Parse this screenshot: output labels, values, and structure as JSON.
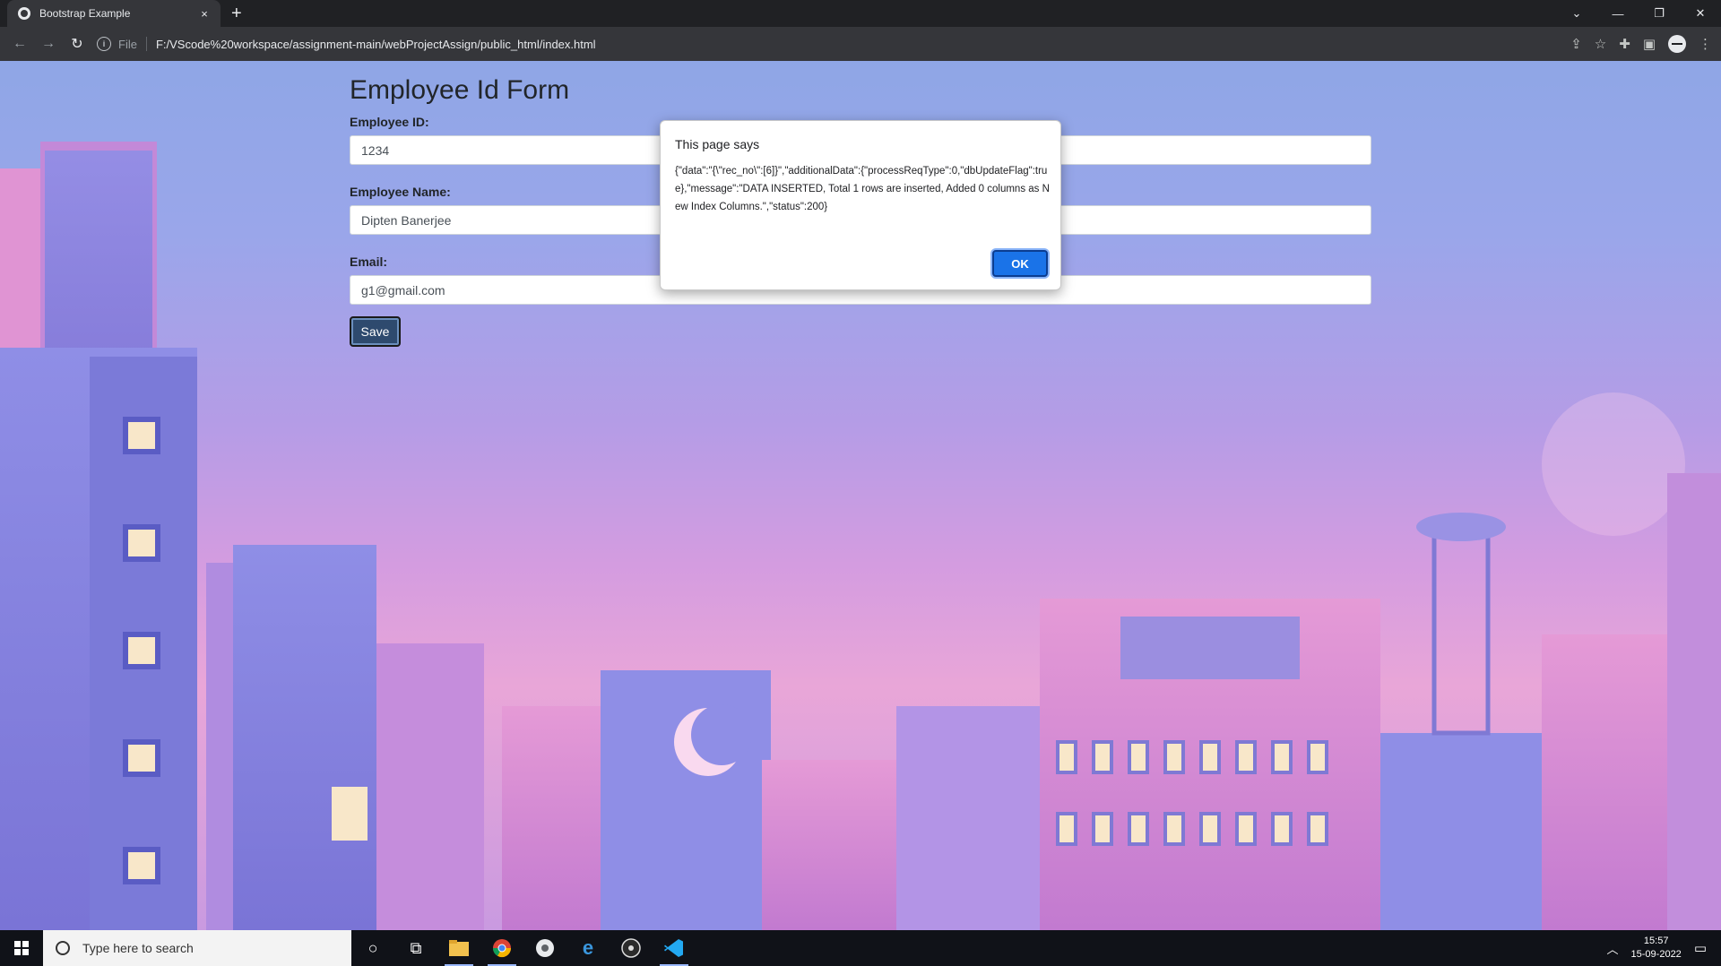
{
  "browser": {
    "tab_title": "Bootstrap Example",
    "tab_close": "×",
    "new_tab": "+",
    "scheme": "File",
    "url": "F:/VScode%20workspace/assignment-main/webProjectAssign/public_html/index.html"
  },
  "form": {
    "title": "Employee Id Form",
    "fields": [
      {
        "label": "Employee ID:",
        "value": "1234"
      },
      {
        "label": "Employee Name:",
        "value": "Dipten Banerjee"
      },
      {
        "label": "Email:",
        "value": "g1@gmail.com"
      }
    ],
    "save_label": "Save"
  },
  "dialog": {
    "title": "This page says",
    "message": "{\"data\":\"{\\\"rec_no\\\":[6]}\",\"additionalData\":{\"processReqType\":0,\"dbUpdateFlag\":true},\"message\":\"DATA INSERTED, Total 1 rows are inserted, Added 0 columns as New Index Columns.\",\"status\":200}",
    "ok_label": "OK"
  },
  "taskbar": {
    "search_placeholder": "Type here to search",
    "time": "15:57",
    "date": "15-09-2022"
  },
  "colors": {
    "accent": "#1a73e8",
    "save_button": "#2e4a6e"
  }
}
